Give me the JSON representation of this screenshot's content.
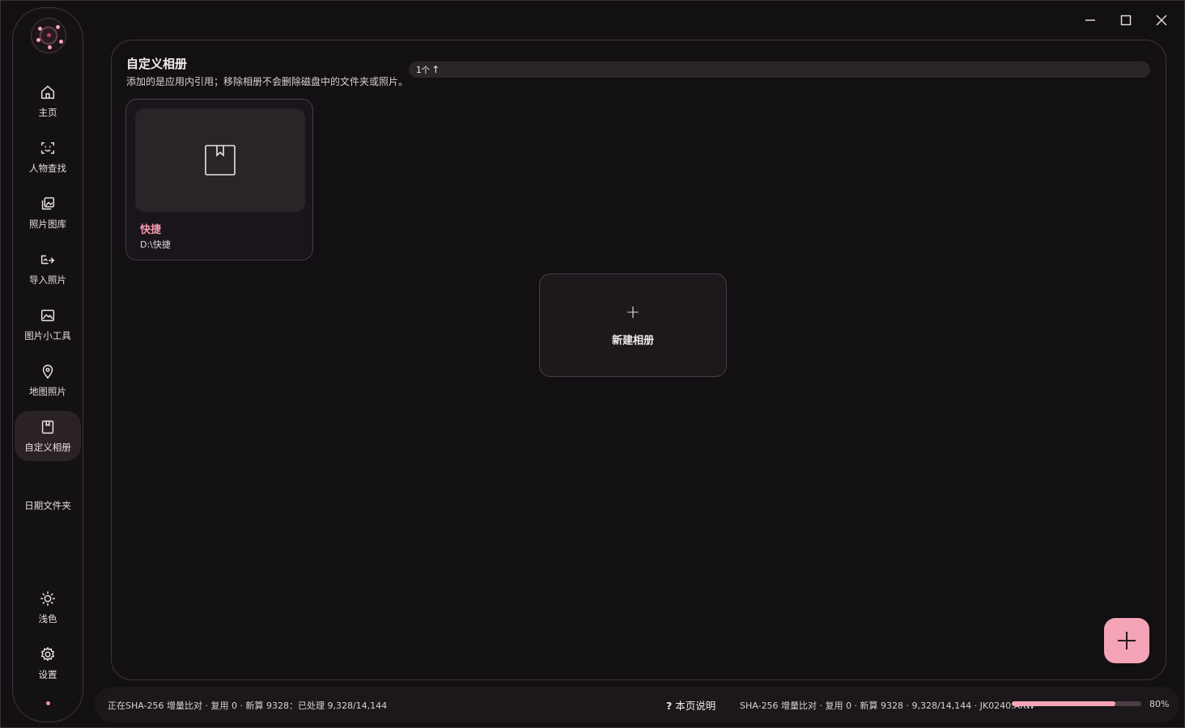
{
  "sidebar": {
    "items": [
      {
        "label": "主页",
        "icon": "home-icon"
      },
      {
        "label": "人物查找",
        "icon": "face-scan-icon"
      },
      {
        "label": "照片图库",
        "icon": "gallery-icon"
      },
      {
        "label": "导入照片",
        "icon": "import-photo-icon"
      },
      {
        "label": "图片小工具",
        "icon": "image-tools-icon"
      },
      {
        "label": "地图照片",
        "icon": "map-pin-icon"
      },
      {
        "label": "自定义相册",
        "icon": "bookmark-album-icon",
        "active": true
      },
      {
        "label": "日期文件夹",
        "icon": ""
      }
    ],
    "bottom_items": [
      {
        "label": "浅色",
        "icon": "sun-icon"
      },
      {
        "label": "设置",
        "icon": "gear-icon"
      }
    ]
  },
  "page": {
    "title": "自定义相册",
    "subtitle": "添加的是应用内引用；移除相册不会删除磁盘中的文件夹或照片。",
    "count": "1个"
  },
  "albums": [
    {
      "name": "快捷",
      "path": "D:\\快捷"
    }
  ],
  "new_album": {
    "label": "新建相册"
  },
  "status": {
    "left": "正在SHA-256 增量比对 · 复用 0 · 新算 9328：已处理 9,328/14,144",
    "help": "本页说明",
    "right": "SHA-256 增量比对 · 复用 0 · 新算 9328 · 9,328/14,144 · JK0240.ARW",
    "progress": 0.8,
    "progress_label": "80%"
  },
  "colors": {
    "accent": "#f5a3b6",
    "background": "#121013",
    "border": "#3f343b"
  }
}
